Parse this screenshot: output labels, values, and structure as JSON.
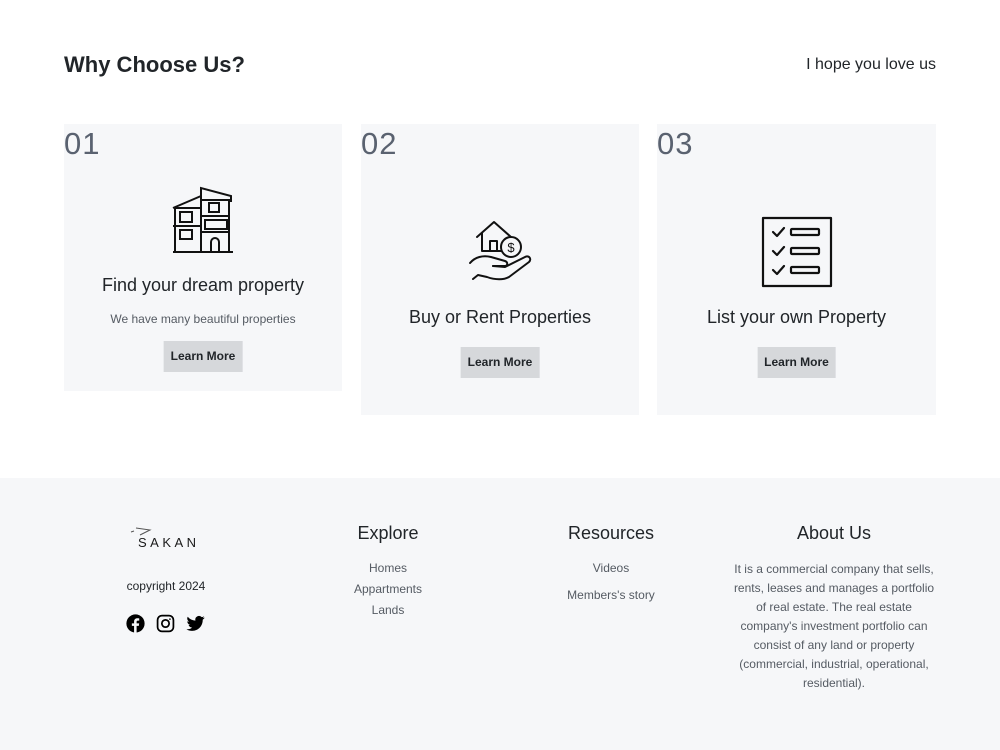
{
  "why": {
    "title": "Why Choose Us?",
    "tagline": "I hope you love us",
    "cards": [
      {
        "number": "01",
        "icon": "house-building-icon",
        "title": "Find your dream property",
        "description": "We have many beautiful properties",
        "button": "Learn More"
      },
      {
        "number": "02",
        "icon": "house-hand-dollar-icon",
        "title": "Buy or Rent Properties",
        "button": "Learn More"
      },
      {
        "number": "03",
        "icon": "checklist-icon",
        "title": "List your own Property",
        "button": "Learn More"
      }
    ]
  },
  "footer": {
    "logo_text": "SAKAN",
    "copyright": "copyright 2024",
    "socials": [
      "facebook-icon",
      "instagram-icon",
      "twitter-icon"
    ],
    "explore": {
      "heading": "Explore",
      "links": [
        "Homes",
        "Appartments",
        "Lands"
      ]
    },
    "resources": {
      "heading": "Resources",
      "links": [
        "Videos",
        "Members's story"
      ]
    },
    "about": {
      "heading": "About Us",
      "text": "It is a commercial company that sells, rents, leases and manages a portfolio of real estate. The real estate company's investment portfolio can consist of any land or property (commercial, industrial, operational, residential)."
    }
  },
  "colors": {
    "card_bg": "#f6f7f9",
    "button_bg": "#d6d8db",
    "footer_bg": "#f6f7f9",
    "text": "#212529",
    "muted": "#555b63"
  }
}
